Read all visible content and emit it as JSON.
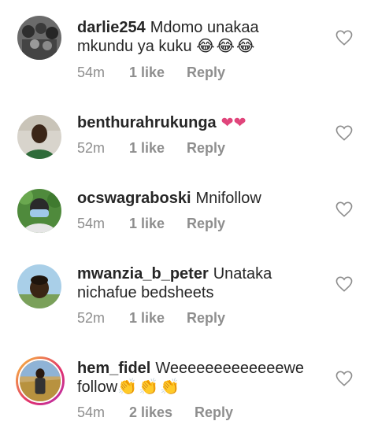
{
  "comments": [
    {
      "username": "darlie254",
      "text": "Mdomo unakaa mkundu ya kuku",
      "emoji": "😂😂😂",
      "time": "54m",
      "likes": "1 like",
      "reply": "Reply",
      "avatar_icon": "group-photo-avatar"
    },
    {
      "username": "benthurahrukunga",
      "text": "",
      "emoji": "❤❤",
      "time": "52m",
      "likes": "1 like",
      "reply": "Reply",
      "avatar_icon": "person-portrait-avatar"
    },
    {
      "username": "ocswagraboski",
      "text": "Mnifollow",
      "emoji": "",
      "time": "54m",
      "likes": "1 like",
      "reply": "Reply",
      "avatar_icon": "masked-person-avatar"
    },
    {
      "username": "mwanzia_b_peter",
      "text": "Unataka nichafue bedsheets",
      "emoji": "",
      "time": "52m",
      "likes": "1 like",
      "reply": "Reply",
      "avatar_icon": "person-outdoor-avatar"
    },
    {
      "username": "hem_fidel",
      "text": "Weeeeeeeeeeeeewe follow",
      "emoji": "👏👏👏",
      "time": "54m",
      "likes": "2 likes",
      "reply": "Reply",
      "avatar_icon": "story-ring-avatar"
    }
  ],
  "colors": {
    "text": "#262626",
    "meta": "#8e8e8e",
    "heart": "#e0457b",
    "story_ring_start": "#f9c33a",
    "story_ring_end": "#b42fb4"
  }
}
